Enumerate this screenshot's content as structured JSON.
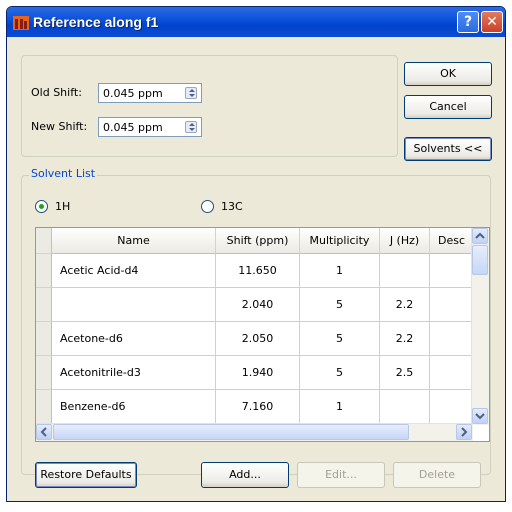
{
  "window": {
    "title": "Reference along f1",
    "help_glyph": "?",
    "close_glyph": "✕"
  },
  "shift": {
    "old_label": "Old Shift:",
    "old_value": "0.045 ppm",
    "new_label": "New Shift:",
    "new_value": "0.045 ppm"
  },
  "buttons": {
    "ok": "OK",
    "cancel": "Cancel",
    "solvents": "Solvents <<",
    "restore": "Restore Defaults",
    "add": "Add...",
    "edit": "Edit...",
    "delete": "Delete"
  },
  "solvent_list": {
    "label": "Solvent List",
    "radio_1h": "1H",
    "radio_13c": "13C",
    "selected": "1H"
  },
  "table": {
    "columns": [
      "Name",
      "Shift (ppm)",
      "Multiplicity",
      "J (Hz)",
      "Desc"
    ],
    "rows": [
      [
        "Acetic Acid-d4",
        "11.650",
        "1",
        "",
        ""
      ],
      [
        "",
        "2.040",
        "5",
        "2.2",
        ""
      ],
      [
        "Acetone-d6",
        "2.050",
        "5",
        "2.2",
        ""
      ],
      [
        "Acetonitrile-d3",
        "1.940",
        "5",
        "2.5",
        ""
      ],
      [
        "Benzene-d6",
        "7.160",
        "1",
        "",
        ""
      ]
    ]
  },
  "icons": {
    "app": "app-icon",
    "spinner": "spinner-arrows-icon",
    "scroll_up": "scroll-up-icon",
    "scroll_down": "scroll-down-icon",
    "scroll_left": "scroll-left-icon",
    "scroll_right": "scroll-right-icon"
  },
  "colors": {
    "titlebar": "#0a4fd9",
    "dialog_bg": "#ece9d8",
    "group_label": "#0046d5",
    "radio_dot": "#21a121"
  }
}
